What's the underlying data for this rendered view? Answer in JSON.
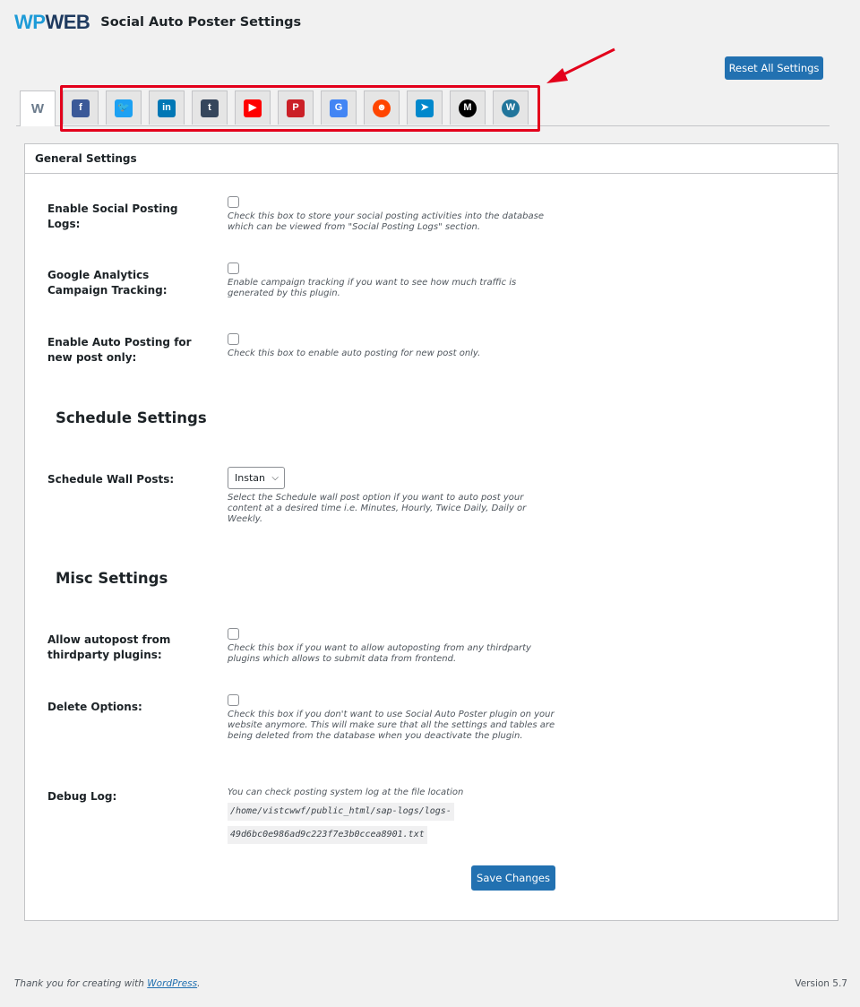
{
  "header": {
    "logo_part1": "WP",
    "logo_part2": "WEB",
    "title": "Social Auto Poster Settings"
  },
  "reset_button": "Reset All Settings",
  "tabs": [
    {
      "name": "wpweb",
      "icon": "wpweb-icon",
      "glyph": "W",
      "color": "#6b7b8c"
    },
    {
      "name": "facebook",
      "icon": "facebook-icon",
      "glyph": "f",
      "color": "#3b5998"
    },
    {
      "name": "twitter",
      "icon": "twitter-icon",
      "glyph": "🐦",
      "color": "#1da1f2"
    },
    {
      "name": "linkedin",
      "icon": "linkedin-icon",
      "glyph": "in",
      "color": "#0077b5"
    },
    {
      "name": "tumblr",
      "icon": "tumblr-icon",
      "glyph": "t",
      "color": "#35465c"
    },
    {
      "name": "youtube",
      "icon": "youtube-icon",
      "glyph": "▶",
      "color": "#ff0000"
    },
    {
      "name": "pinterest",
      "icon": "pinterest-icon",
      "glyph": "P",
      "color": "#cb2027"
    },
    {
      "name": "google-my-business",
      "icon": "google-my-business-icon",
      "glyph": "G",
      "color": "#4285f4"
    },
    {
      "name": "reddit",
      "icon": "reddit-icon",
      "glyph": "☻",
      "color": "#ff4500"
    },
    {
      "name": "telegram",
      "icon": "telegram-icon",
      "glyph": "➤",
      "color": "#0088cc"
    },
    {
      "name": "medium",
      "icon": "medium-icon",
      "glyph": "M",
      "color": "#000000"
    },
    {
      "name": "wordpress",
      "icon": "wordpress-icon",
      "glyph": "W",
      "color": "#21759b"
    }
  ],
  "panel": {
    "title": "General Settings",
    "enable_logs": {
      "label": "Enable Social Posting Logs:",
      "desc": "Check this box to store your social posting activities into the database which can be viewed from \"Social Posting Logs\" section."
    },
    "ga_tracking": {
      "label": "Google Analytics Campaign Tracking:",
      "desc": "Enable campaign tracking if you want to see how much traffic is generated by this plugin."
    },
    "new_post_only": {
      "label": "Enable Auto Posting for new post only:",
      "desc": "Check this box to enable auto posting for new post only."
    },
    "schedule_title": "Schedule Settings",
    "schedule_wall": {
      "label": "Schedule Wall Posts:",
      "selected": "Instan",
      "desc": "Select the Schedule wall post option if you want to auto post your content at a desired time i.e. Minutes, Hourly, Twice Daily, Daily or Weekly."
    },
    "misc_title": "Misc Settings",
    "thirdparty": {
      "label": "Allow autopost from thirdparty plugins:",
      "desc": "Check this box if you want to allow autoposting from any thirdparty plugins which allows to submit data from frontend."
    },
    "delete_options": {
      "label": "Delete Options:",
      "desc": "Check this box if you don't want to use Social Auto Poster plugin on your website anymore. This will make sure that all the settings and tables are being deleted from the database when you deactivate the plugin."
    },
    "debug_log": {
      "label": "Debug Log:",
      "desc": "You can check posting system log at the file location",
      "path1": "/home/vistcwwf/public_html/sap-logs/logs-",
      "path2": "49d6bc0e986ad9c223f7e3b0ccea8901.txt"
    },
    "save_button": "Save Changes"
  },
  "footer": {
    "thanks_prefix": "Thank you for creating with ",
    "thanks_link": "WordPress",
    "thanks_suffix": ".",
    "version": "Version 5.7"
  }
}
